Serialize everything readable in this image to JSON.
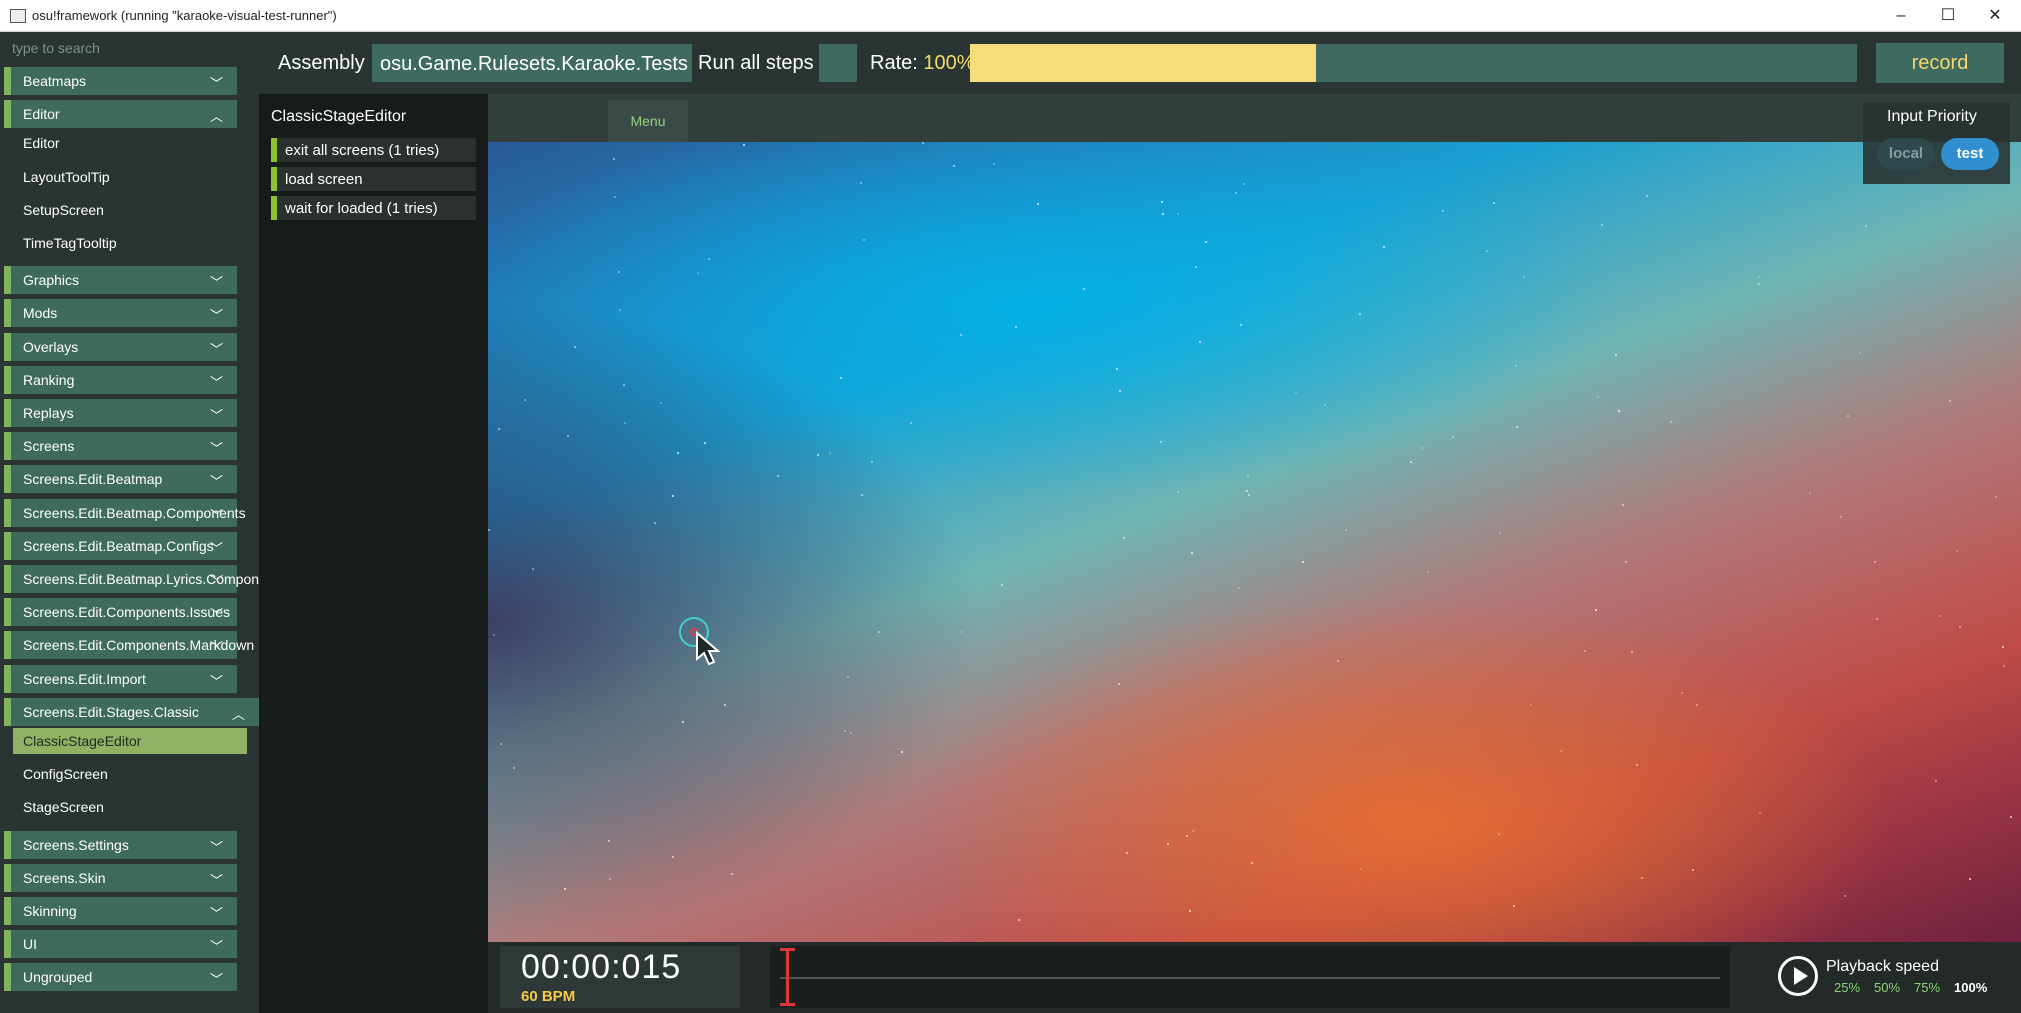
{
  "window": {
    "title": "osu!framework (running \"karaoke-visual-test-runner\")",
    "controls": [
      "–",
      "☐",
      "✕"
    ]
  },
  "sidebar": {
    "search_placeholder": "type to search",
    "groups": [
      {
        "label": "Beatmaps",
        "expanded": false
      },
      {
        "label": "Editor",
        "expanded": true,
        "items": [
          "Editor",
          "LayoutToolTip",
          "SetupScreen",
          "TimeTagTooltip"
        ]
      },
      {
        "label": "Graphics",
        "expanded": false
      },
      {
        "label": "Mods",
        "expanded": false
      },
      {
        "label": "Overlays",
        "expanded": false
      },
      {
        "label": "Ranking",
        "expanded": false
      },
      {
        "label": "Replays",
        "expanded": false
      },
      {
        "label": "Screens",
        "expanded": false
      },
      {
        "label": "Screens.Edit.Beatmap",
        "expanded": false
      },
      {
        "label": "Screens.Edit.Beatmap.Components",
        "expanded": false
      },
      {
        "label": "Screens.Edit.Beatmap.Configs",
        "expanded": false
      },
      {
        "label": "Screens.Edit.Beatmap.Lyrics.Components",
        "expanded": false
      },
      {
        "label": "Screens.Edit.Components.Issues",
        "expanded": false
      },
      {
        "label": "Screens.Edit.Components.Markdown",
        "expanded": false
      },
      {
        "label": "Screens.Edit.Import",
        "expanded": false
      },
      {
        "label": "Screens.Edit.Stages.Classic",
        "expanded": true,
        "items": [
          "ClassicStageEditor",
          "ConfigScreen",
          "StageScreen"
        ],
        "selected": "ClassicStageEditor"
      },
      {
        "label": "Screens.Settings",
        "expanded": false
      },
      {
        "label": "Screens.Skin",
        "expanded": false
      },
      {
        "label": "Skinning",
        "expanded": false
      },
      {
        "label": "UI",
        "expanded": false
      },
      {
        "label": "Ungrouped",
        "expanded": false
      }
    ]
  },
  "toolbar": {
    "assembly_label": "Assembly",
    "assembly_value": "osu.Game.Rulesets.Karaoke.Tests",
    "run_all_label": "Run all steps",
    "rate_label": "Rate:",
    "rate_value": "100%",
    "rate_fraction": 0.39,
    "record_label": "record"
  },
  "steps": {
    "scene_title": "ClassicStageEditor",
    "items": [
      "exit all screens (1 tries)",
      "load screen",
      "wait for loaded (1 tries)"
    ]
  },
  "stage": {
    "menu_label": "Menu",
    "input_priority": {
      "title": "Input Priority",
      "options": [
        "local",
        "test"
      ],
      "selected": "test"
    }
  },
  "bottom": {
    "time": "00:00:015",
    "bpm": "60 BPM",
    "playback_title": "Playback speed",
    "speeds": [
      "25%",
      "50%",
      "75%",
      "100%"
    ],
    "selected_speed": "100%"
  },
  "colors": {
    "accent_green": "#82b35f",
    "rate_yellow": "#f7dc7a",
    "timeline_red": "#e0353a",
    "test_blue": "#2f8fcf"
  }
}
